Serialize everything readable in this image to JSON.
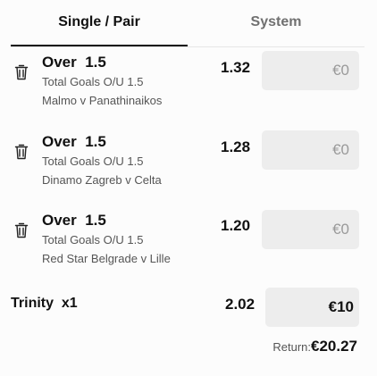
{
  "tabs": {
    "single": "Single / Pair",
    "system": "System"
  },
  "bets": [
    {
      "title": "Over  1.5",
      "market": "Total Goals O/U 1.5",
      "match": "Malmo v Panathinaikos",
      "odds": "1.32",
      "stake_placeholder": "€0"
    },
    {
      "title": "Over  1.5",
      "market": "Total Goals O/U 1.5",
      "match": "Dinamo Zagreb v Celta",
      "odds": "1.28",
      "stake_placeholder": "€0"
    },
    {
      "title": "Over  1.5",
      "market": "Total Goals O/U 1.5",
      "match": "Red Star Belgrade v Lille",
      "odds": "1.20",
      "stake_placeholder": "€0"
    }
  ],
  "combo": {
    "label": "Trinity  x1",
    "odds": "2.02",
    "stake": "€10"
  },
  "return": {
    "label": "Return:",
    "value": "€20.27"
  },
  "icons": {
    "delete": "trash-icon"
  }
}
